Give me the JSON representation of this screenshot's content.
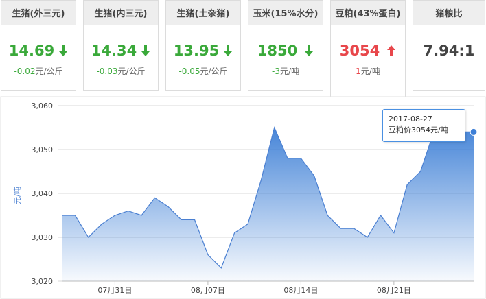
{
  "cards": [
    {
      "title": "生猪(外三元)",
      "price": "14.69",
      "trend": "down",
      "change_value": "-0.02",
      "change_unit": "元/公斤"
    },
    {
      "title": "生猪(内三元)",
      "price": "14.34",
      "trend": "down",
      "change_value": "-0.03",
      "change_unit": "元/公斤"
    },
    {
      "title": "生猪(土杂猪)",
      "price": "13.95",
      "trend": "down",
      "change_value": "-0.05",
      "change_unit": "元/公斤"
    },
    {
      "title": "玉米(15%水分)",
      "price": "1850",
      "trend": "down",
      "change_value": "-3",
      "change_unit": "元/吨"
    },
    {
      "title": "豆粕(43%蛋白)",
      "price": "3054",
      "trend": "up",
      "change_value": "1",
      "change_unit": "元/吨",
      "active": true
    },
    {
      "title": "猪粮比",
      "price": "7.94:1",
      "trend": "none",
      "change_value": "",
      "change_unit": ""
    }
  ],
  "colors": {
    "down": "#3aa93a",
    "up": "#e8474b",
    "line": "#4a7fd1",
    "fill_top": "#3d7fd6"
  },
  "tooltip": {
    "date": "2017-08-27",
    "text": "豆粕价3054元/吨"
  },
  "chart_data": {
    "type": "area",
    "ylabel": "元/吨",
    "ylim": [
      3020,
      3060
    ],
    "yticks": [
      3020,
      3030,
      3040,
      3050,
      3060
    ],
    "yticklabels": [
      "3,020",
      "3,030",
      "3,040",
      "3,050",
      "3,060"
    ],
    "xticklabels": [
      "07月31日",
      "08月07日",
      "08月14日",
      "08月21日"
    ],
    "x": [
      "2017-07-27",
      "2017-07-28",
      "2017-07-29",
      "2017-07-30",
      "2017-07-31",
      "2017-08-01",
      "2017-08-02",
      "2017-08-03",
      "2017-08-04",
      "2017-08-05",
      "2017-08-06",
      "2017-08-07",
      "2017-08-08",
      "2017-08-09",
      "2017-08-10",
      "2017-08-11",
      "2017-08-12",
      "2017-08-13",
      "2017-08-14",
      "2017-08-15",
      "2017-08-16",
      "2017-08-17",
      "2017-08-18",
      "2017-08-19",
      "2017-08-20",
      "2017-08-21",
      "2017-08-22",
      "2017-08-23",
      "2017-08-24",
      "2017-08-25",
      "2017-08-26",
      "2017-08-27"
    ],
    "values": [
      3035,
      3035,
      3030,
      3033,
      3035,
      3036,
      3035,
      3039,
      3037,
      3034,
      3034,
      3026,
      3023,
      3031,
      3033,
      3043,
      3055,
      3048,
      3048,
      3044,
      3035,
      3032,
      3032,
      3030,
      3035,
      3031,
      3042,
      3045,
      3054,
      3055,
      3054,
      3054
    ],
    "grid": true,
    "legend": "none"
  }
}
